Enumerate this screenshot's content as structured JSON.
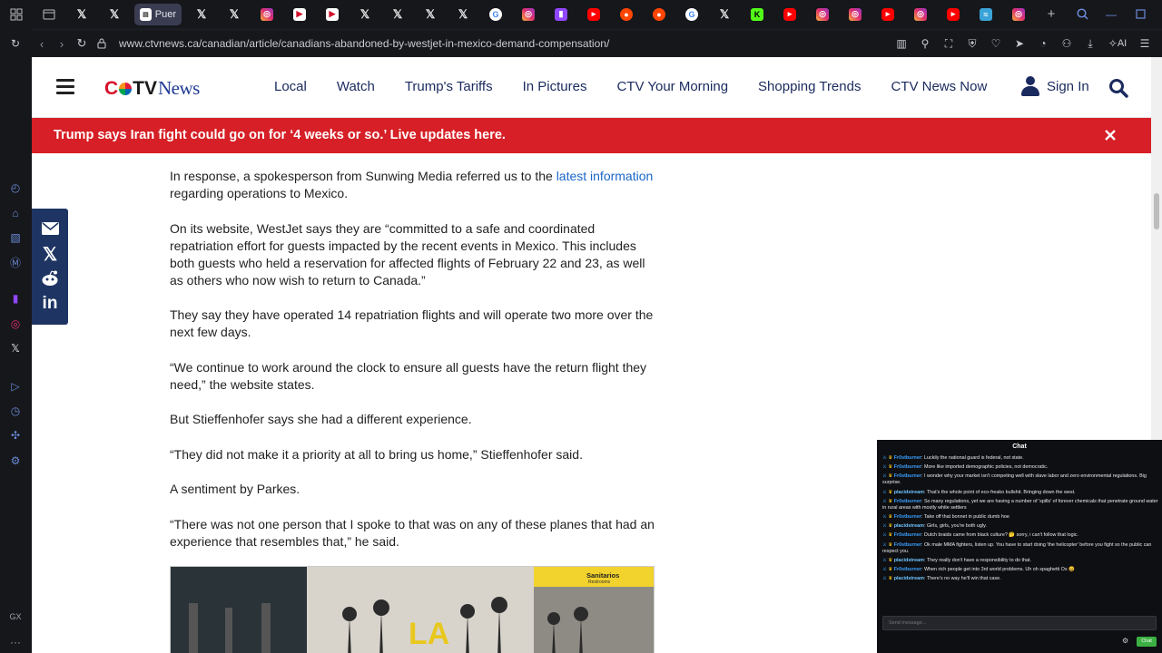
{
  "browser": {
    "active_tab_label": "Puer",
    "url": "www.ctvnews.ca/canadian/article/canadians-abandoned-by-westjet-in-mexico-demand-compensation/",
    "ai_label": "AI",
    "gx_label": "GX",
    "sidebar_more": "···"
  },
  "site": {
    "logo_c": "C",
    "logo_tv": "TV",
    "logo_news": "News",
    "nav": [
      "Local",
      "Watch",
      "Trump's Tariffs",
      "In Pictures",
      "CTV Your Morning",
      "Shopping Trends",
      "CTV News Now"
    ],
    "sign_in": "Sign In"
  },
  "breaking": {
    "text": "Trump says Iran fight could go on for ‘4 weeks or so.’ Live updates here."
  },
  "article": {
    "p1_before_link": "In response, a spokesperson from Sunwing Media referred us to the ",
    "p1_link": "latest information",
    "p1_after_link": " regarding operations to Mexico.",
    "p2": "On its website, WestJet says they are “committed to a safe and coordinated repatriation effort for guests impacted by the recent events in Mexico. This includes both guests who held a reservation for affected flights of February 22 and 23, as well as others who now wish to return to Canada.”",
    "p3": "They say they have operated 14 repatriation flights and will operate two more over the next few days.",
    "p4": "“We continue to work around the clock to ensure all guests have the return flight they need,” the website states.",
    "p5": "But Stieffenhofer says she had a different experience.",
    "p6": "“They did not make it a priority at all to bring us home,” Stieffenhofer said.",
    "p7": "A sentiment by Parkes.",
    "p8": "“There was not one person that I spoke to that was on any of these planes that had an experience that resembles that,” he said."
  },
  "image_signs": {
    "sign_text": "Sanitarios",
    "sign_sub": "Restrooms"
  },
  "chat": {
    "title": "Chat",
    "messages": [
      {
        "user": "Fr0stburner",
        "user_color": "#3aa0ff",
        "text": ": Luckily the national guard is federal, not state."
      },
      {
        "user": "Fr0stburner",
        "user_color": "#3aa0ff",
        "text": ": More like imported demographic policies, not democratic."
      },
      {
        "user": "Fr0stburner",
        "user_color": "#3aa0ff",
        "text": ": I wonder why your market isn't competing well with slave labor and zero environmental regulations. Big surprise."
      },
      {
        "user": "placidstream",
        "user_color": "#6fc3ff",
        "text": ": That's the whole point of eco-freako bullshit. Bringing down the west."
      },
      {
        "user": "Fr0stburner",
        "user_color": "#3aa0ff",
        "text": ": So many regulations, yet we are having a number of 'spills' of forever chemicals that penetrate ground water in rural areas with mostly white settlers"
      },
      {
        "user": "Fr0stburner",
        "user_color": "#3aa0ff",
        "text": ": Take off that bonnet in public dumb hoe"
      },
      {
        "user": "placidstream",
        "user_color": "#6fc3ff",
        "text": ": Girls, girls, you're both ugly."
      },
      {
        "user": "Fr0stburner",
        "user_color": "#3aa0ff",
        "text": ": Dutch braids came from black culture? 🤔 sorry, i can't follow that logic."
      },
      {
        "user": "Fr0stburner",
        "user_color": "#3aa0ff",
        "text": ": Ok male MMA fighters, listen up. You have to start doing 'the helicopter' before you fight so the public can respect you."
      },
      {
        "user": "placidstream",
        "user_color": "#6fc3ff",
        "text": ": They really don't have a responsibility to do that."
      },
      {
        "user": "Fr0stburner",
        "user_color": "#3aa0ff",
        "text": ": When rich people get into 3rd world problems. Uh oh spaghetti Os 😄"
      },
      {
        "user": "placidstream",
        "user_color": "#6fc3ff",
        "text": ": There's no way he'll win that case."
      }
    ],
    "input_placeholder": "Send message...",
    "send_label": "Chat"
  },
  "colors": {
    "ctv_red": "#d61f26",
    "ctv_navy": "#1a2a5e",
    "link_blue": "#1a66c8",
    "share_bar": "#1e3563"
  }
}
